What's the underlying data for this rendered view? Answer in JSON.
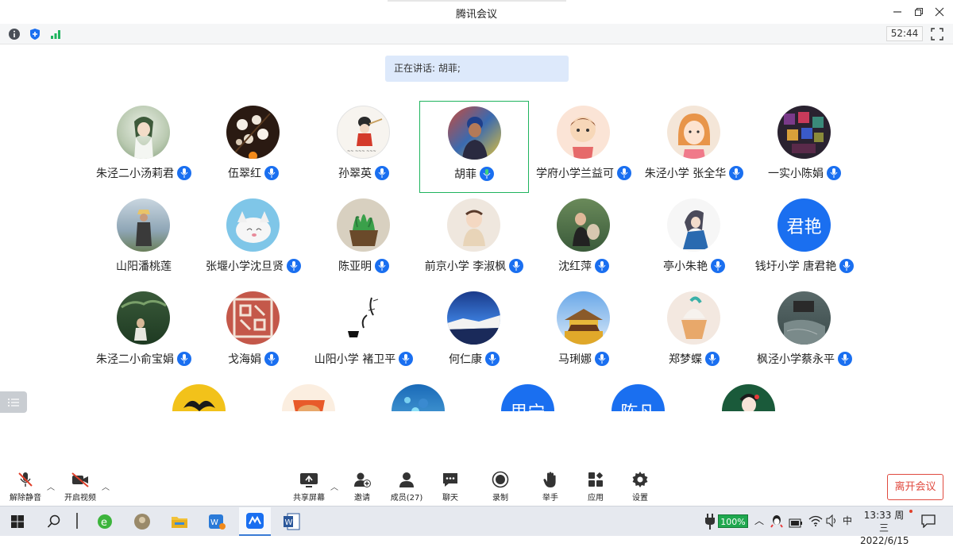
{
  "window": {
    "title": "腾讯会议",
    "timer": "52:44"
  },
  "speaking": {
    "label": "正在讲话: 胡菲;"
  },
  "participants": [
    {
      "name": "朱泾二小汤莉君",
      "mic": true
    },
    {
      "name": "伍翠红",
      "mic": true
    },
    {
      "name": "孙翠英",
      "mic": true
    },
    {
      "name": "胡菲",
      "mic": true,
      "speaking": true
    },
    {
      "name": "学府小学兰益可",
      "mic": true
    },
    {
      "name": "朱泾小学  张全华",
      "mic": true
    },
    {
      "name": "一实小陈娟",
      "mic": true
    },
    {
      "name": "山阳潘桃莲",
      "mic": false
    },
    {
      "name": "张堰小学沈旦贤",
      "mic": true
    },
    {
      "name": "陈亚明",
      "mic": true
    },
    {
      "name": "前京小学 李淑枫",
      "mic": true
    },
    {
      "name": "沈红萍",
      "mic": true
    },
    {
      "name": "亭小朱艳",
      "mic": true
    },
    {
      "name": "钱圩小学 唐君艳",
      "mic": true,
      "avatar_text": "君艳"
    },
    {
      "name": "朱泾二小俞宝娟",
      "mic": true
    },
    {
      "name": "戈海娟",
      "mic": true
    },
    {
      "name": "山阳小学 褚卫平",
      "mic": true
    },
    {
      "name": "何仁康",
      "mic": true
    },
    {
      "name": "马琍娜",
      "mic": true
    },
    {
      "name": "郑梦蝶",
      "mic": true
    },
    {
      "name": "枫泾小学蔡永平",
      "mic": true
    },
    {
      "name": "",
      "mic": false
    },
    {
      "name": "",
      "mic": false
    },
    {
      "name": "",
      "mic": false
    },
    {
      "name": "",
      "mic": false,
      "avatar_text": "思宁"
    },
    {
      "name": "",
      "mic": false,
      "avatar_text": "陈凡"
    },
    {
      "name": "",
      "mic": false
    }
  ],
  "toolbar": {
    "unmute": "解除静音",
    "start_video": "开启视频",
    "share_screen": "共享屏幕",
    "invite": "邀请",
    "members": "成员(27)",
    "chat": "聊天",
    "record": "录制",
    "raise_hand": "举手",
    "apps": "应用",
    "settings": "设置",
    "leave": "离开会议"
  },
  "taskbar": {
    "battery": "100%",
    "ime": "中",
    "time": "13:33 周三",
    "date": "2022/6/15"
  },
  "colors": {
    "accent": "#1a6ff0",
    "speaking_border": "#1fb45e",
    "leave": "#e04a3f"
  }
}
